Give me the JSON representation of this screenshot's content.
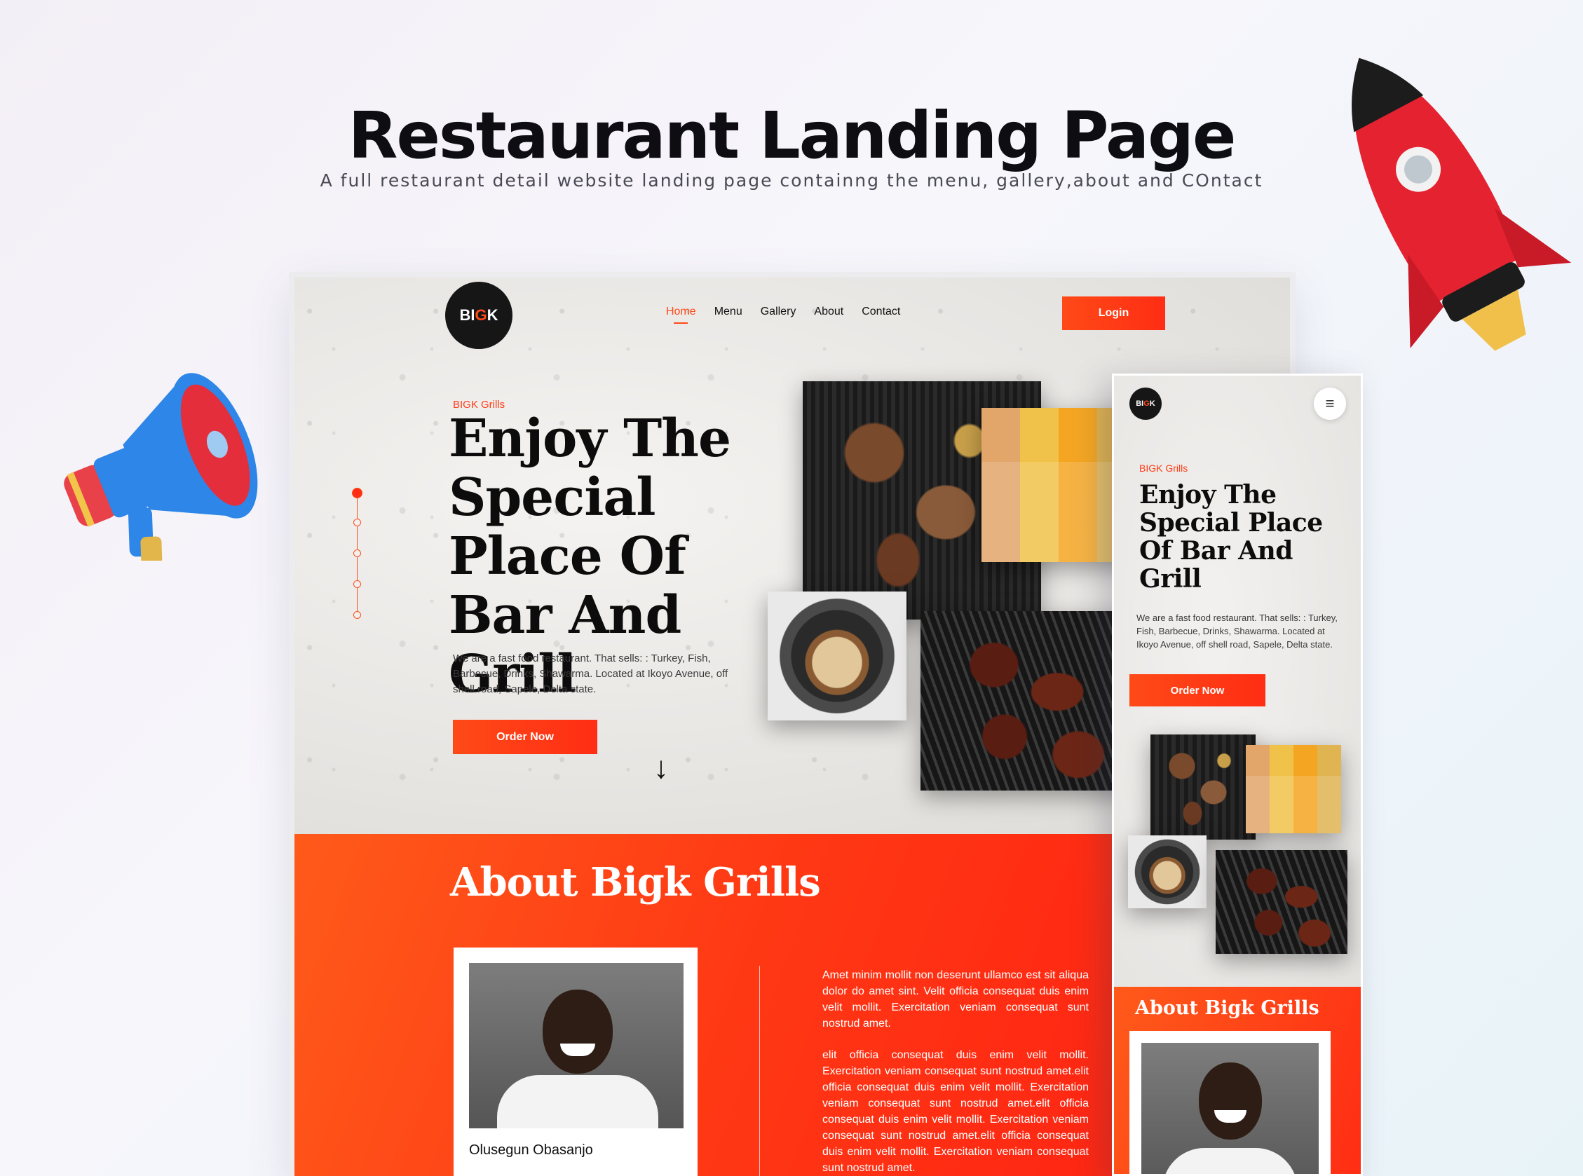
{
  "showcase": {
    "title": "Restaurant Landing Page",
    "subtitle": "A full restaurant detail website landing page containng the menu, gallery,about and COntact"
  },
  "desktop": {
    "logo": {
      "text_a": "BI",
      "text_b": "G",
      "text_c": "K",
      "icon": "grill-logo-icon"
    },
    "nav": [
      {
        "label": "Home",
        "active": true
      },
      {
        "label": "Menu",
        "active": false
      },
      {
        "label": "Gallery",
        "active": false
      },
      {
        "label": "About",
        "active": false
      },
      {
        "label": "Contact",
        "active": false
      }
    ],
    "login_label": "Login",
    "hero": {
      "eyebrow": "BIGK Grills",
      "title": "Enjoy The Special Place Of Bar And Grill",
      "description": "We are  a fast food restaurant. That sells: : Turkey, Fish, Barbecue, Drinks, Shawarma. Located at Ikoyo Avenue, off shell road, Sapele, Delta state.",
      "order_label": "Order Now",
      "arrow": "↓"
    },
    "about": {
      "title": "About Bigk Grills",
      "chef_name": "Olusegun Obasanjo",
      "paragraph_1": "Amet minim mollit non deserunt ullamco est sit aliqua dolor do amet sint. Velit officia consequat duis enim velit mollit. Exercitation veniam consequat sunt nostrud amet.",
      "paragraph_2": "elit officia consequat duis enim velit mollit. Exercitation veniam consequat sunt nostrud amet.elit officia consequat duis enim velit mollit. Exercitation veniam consequat sunt nostrud amet.elit officia consequat duis enim velit mollit. Exercitation veniam consequat sunt nostrud amet.elit officia consequat duis enim velit mollit. Exercitation veniam consequat sunt nostrud amet."
    }
  },
  "mobile": {
    "logo": {
      "text_a": "BI",
      "text_b": "G",
      "text_c": "K"
    },
    "menu_icon": "≡",
    "eyebrow": "BIGK Grills",
    "title": "Enjoy The Special Place Of Bar And Grill",
    "description": "We are  a fast food restaurant. That sells: : Turkey, Fish, Barbecue, Drinks, Shawarma. Located at Ikoyo Avenue, off shell road, Sapele, Delta state.",
    "order_label": "Order Now",
    "about_title": "About Bigk Grills"
  },
  "colors": {
    "accent": "#FF3B17",
    "text": "#0C0C0C",
    "background": "#EBEAE8"
  }
}
